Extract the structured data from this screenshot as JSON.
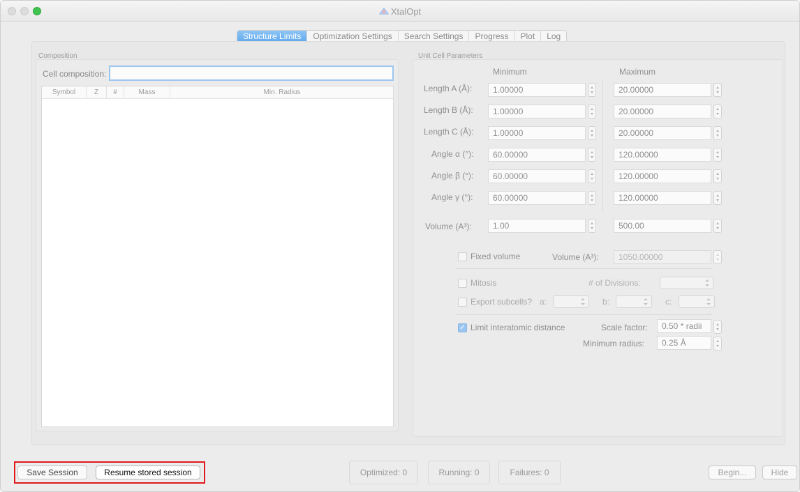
{
  "window": {
    "title": "XtalOpt"
  },
  "tabs": [
    {
      "label": "Structure Limits",
      "active": true
    },
    {
      "label": "Optimization Settings",
      "active": false
    },
    {
      "label": "Search Settings",
      "active": false
    },
    {
      "label": "Progress",
      "active": false
    },
    {
      "label": "Plot",
      "active": false
    },
    {
      "label": "Log",
      "active": false
    }
  ],
  "composition": {
    "group_label": "Composition",
    "cell_label": "Cell composition:",
    "cell_value": "",
    "columns": [
      "Symbol",
      "Z",
      "#",
      "Mass",
      "Min. Radius"
    ]
  },
  "unit_cell": {
    "group_label": "Unit Cell Parameters",
    "min_header": "Minimum",
    "max_header": "Maximum",
    "rows": [
      {
        "label": "Length A (Å):",
        "min": "1.00000",
        "max": "20.00000"
      },
      {
        "label": "Length B (Å):",
        "min": "1.00000",
        "max": "20.00000"
      },
      {
        "label": "Length C (Å):",
        "min": "1.00000",
        "max": "20.00000"
      },
      {
        "label": "Angle α (°):",
        "min": "60.00000",
        "max": "120.00000"
      },
      {
        "label": "Angle β (°):",
        "min": "60.00000",
        "max": "120.00000"
      },
      {
        "label": "Angle γ (°):",
        "min": "60.00000",
        "max": "120.00000"
      }
    ],
    "volume": {
      "label": "Volume (A³):",
      "min": "1.00",
      "max": "500.00"
    }
  },
  "fixed_volume": {
    "label": "Fixed volume",
    "checked": false,
    "volume_label": "Volume (A³):",
    "volume_value": "1050.00000"
  },
  "mitosis": {
    "label": "Mitosis",
    "checked": false,
    "divisions_label": "# of Divisions:"
  },
  "export_subcells": {
    "label": "Export subcells?",
    "checked": false,
    "a_label": "a:",
    "b_label": "b:",
    "c_label": "c:"
  },
  "interatomic": {
    "label": "Limit interatomic distance",
    "checked": true,
    "scale_label": "Scale factor:",
    "scale_value": "0.50 * radii",
    "min_radius_label": "Minimum radius:",
    "min_radius_value": "0.25 Å"
  },
  "bottom": {
    "save_label": "Save Session",
    "resume_label": "Resume stored session",
    "optimized": "Optimized: 0",
    "running": "Running: 0",
    "failures": "Failures: 0",
    "begin_label": "Begin...",
    "hide_label": "Hide"
  },
  "colors": {
    "accent": "#61a9ee",
    "highlight": "#e0191f",
    "maximize": "#3fc34d"
  }
}
